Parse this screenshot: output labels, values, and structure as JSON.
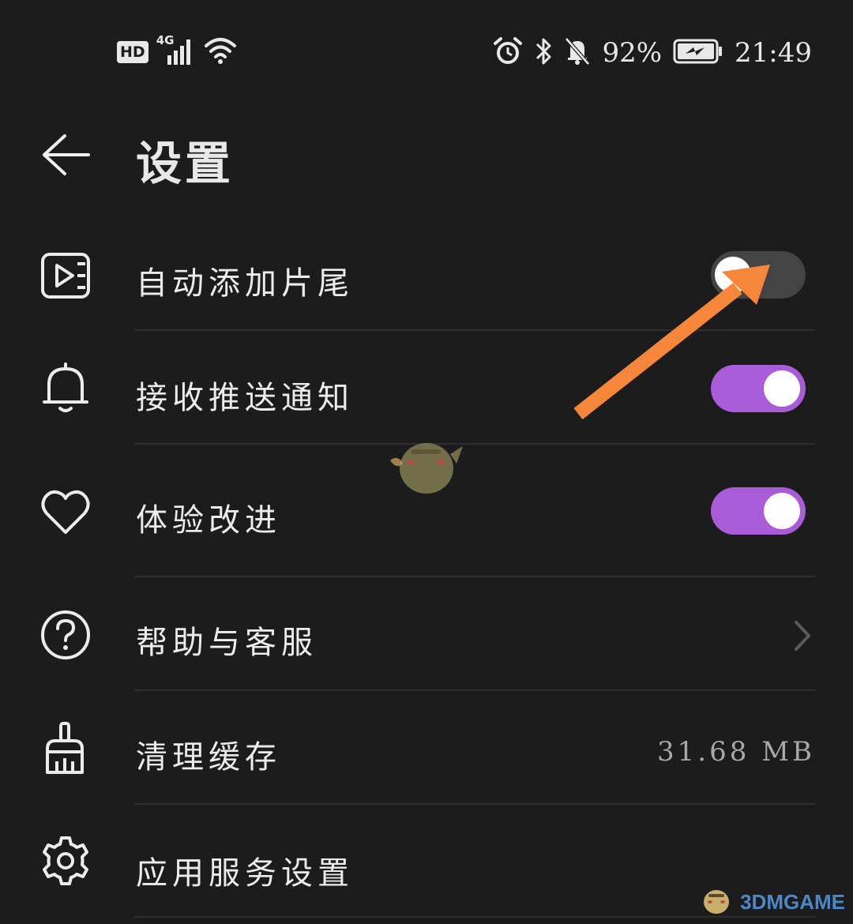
{
  "status_bar": {
    "hd": "HD",
    "network": "4G",
    "battery_percent": "92%",
    "time": "21:49",
    "icons": [
      "signal-icon",
      "wifi-icon",
      "alarm-icon",
      "bluetooth-icon",
      "mute-icon",
      "battery-charging-icon"
    ]
  },
  "header": {
    "title": "设置"
  },
  "settings": {
    "auto_end": {
      "label": "自动添加片尾",
      "icon": "video-icon",
      "enabled": false
    },
    "push": {
      "label": "接收推送通知",
      "icon": "bell-icon",
      "enabled": true
    },
    "improve": {
      "label": "体验改进",
      "icon": "heart-icon",
      "enabled": true
    },
    "help": {
      "label": "帮助与客服",
      "icon": "help-icon"
    },
    "cache": {
      "label": "清理缓存",
      "icon": "broom-icon",
      "value": "31.68 MB"
    },
    "services": {
      "label": "应用服务设置",
      "icon": "gear-icon"
    }
  },
  "watermark": {
    "text": "3DMGAME"
  },
  "colors": {
    "background": "#1c1c1c",
    "toggle_on": "#a85cd8",
    "toggle_off": "#444444",
    "annotation_arrow": "#f5863a"
  }
}
